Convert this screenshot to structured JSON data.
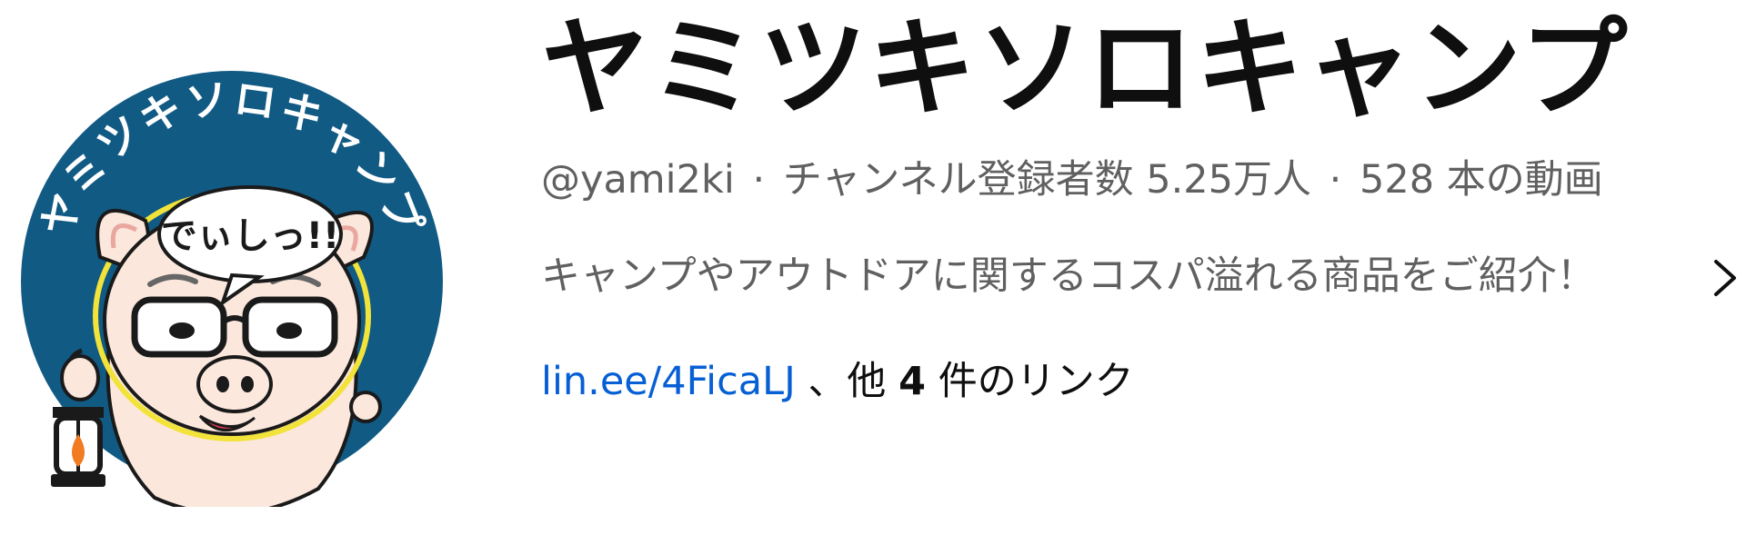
{
  "channel": {
    "name": "ヤミツキソロキャンプ",
    "handle": "@yami2ki",
    "separator": "·",
    "subscribers": "チャンネル登録者数 5.25万人",
    "videos": "528 本の動画",
    "description": "キャンプやアウトドアに関するコスパ溢れる商品をご紹介！",
    "links": {
      "primary": "lin.ee/4FicaLJ",
      "middle": "、他",
      "count": "4",
      "suffix": "件のリンク"
    }
  },
  "avatar": {
    "ring_text": "ヤミツキソロキャンプ",
    "speech_bubble": "でぃしっ!!",
    "colors": {
      "ring": "#115a84",
      "skin": "#fbe7dc",
      "outline": "#1a1a1a",
      "flame": "#f07b22"
    }
  },
  "icons": {
    "chevron": "chevron-right-icon"
  },
  "colors": {
    "link": "#065fd4",
    "secondary_text": "#606060",
    "primary_text": "#0f0f0f"
  }
}
